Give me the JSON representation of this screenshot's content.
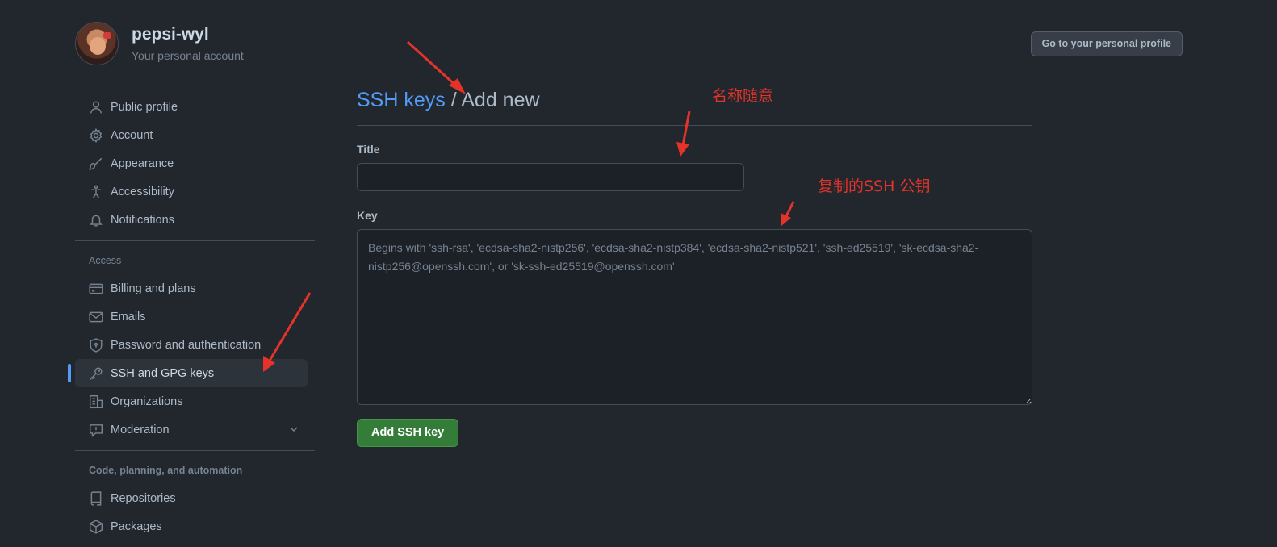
{
  "account": {
    "username": "pepsi-wyl",
    "subtitle": "Your personal account",
    "profile_button": "Go to your personal profile"
  },
  "sidebar": {
    "items_top": [
      {
        "label": "Public profile",
        "icon": "person-icon"
      },
      {
        "label": "Account",
        "icon": "gear-icon"
      },
      {
        "label": "Appearance",
        "icon": "paintbrush-icon"
      },
      {
        "label": "Accessibility",
        "icon": "accessibility-icon"
      },
      {
        "label": "Notifications",
        "icon": "bell-icon"
      }
    ],
    "section_access": "Access",
    "items_access": [
      {
        "label": "Billing and plans",
        "icon": "credit-card-icon"
      },
      {
        "label": "Emails",
        "icon": "mail-icon"
      },
      {
        "label": "Password and authentication",
        "icon": "shield-lock-icon"
      },
      {
        "label": "SSH and GPG keys",
        "icon": "key-icon",
        "active": true
      },
      {
        "label": "Organizations",
        "icon": "organization-icon"
      },
      {
        "label": "Moderation",
        "icon": "report-icon",
        "expandable": true
      }
    ],
    "section_code": "Code, planning, and automation",
    "items_code": [
      {
        "label": "Repositories",
        "icon": "repo-icon"
      },
      {
        "label": "Packages",
        "icon": "package-icon"
      }
    ]
  },
  "main": {
    "breadcrumb_link": "SSH keys",
    "breadcrumb_separator": " / ",
    "breadcrumb_current": "Add new",
    "title_label": "Title",
    "title_value": "",
    "key_label": "Key",
    "key_placeholder": "Begins with 'ssh-rsa', 'ecdsa-sha2-nistp256', 'ecdsa-sha2-nistp384', 'ecdsa-sha2-nistp521', 'ssh-ed25519', 'sk-ecdsa-sha2-nistp256@openssh.com', or 'sk-ssh-ed25519@openssh.com'",
    "submit_button": "Add SSH key"
  },
  "annotations": {
    "title_note": "名称随意",
    "key_note": "复制的SSH 公钥",
    "color": "#e5332a"
  },
  "colors": {
    "background": "#22272e",
    "accent_link": "#539bf5",
    "primary_button": "#347d39"
  }
}
